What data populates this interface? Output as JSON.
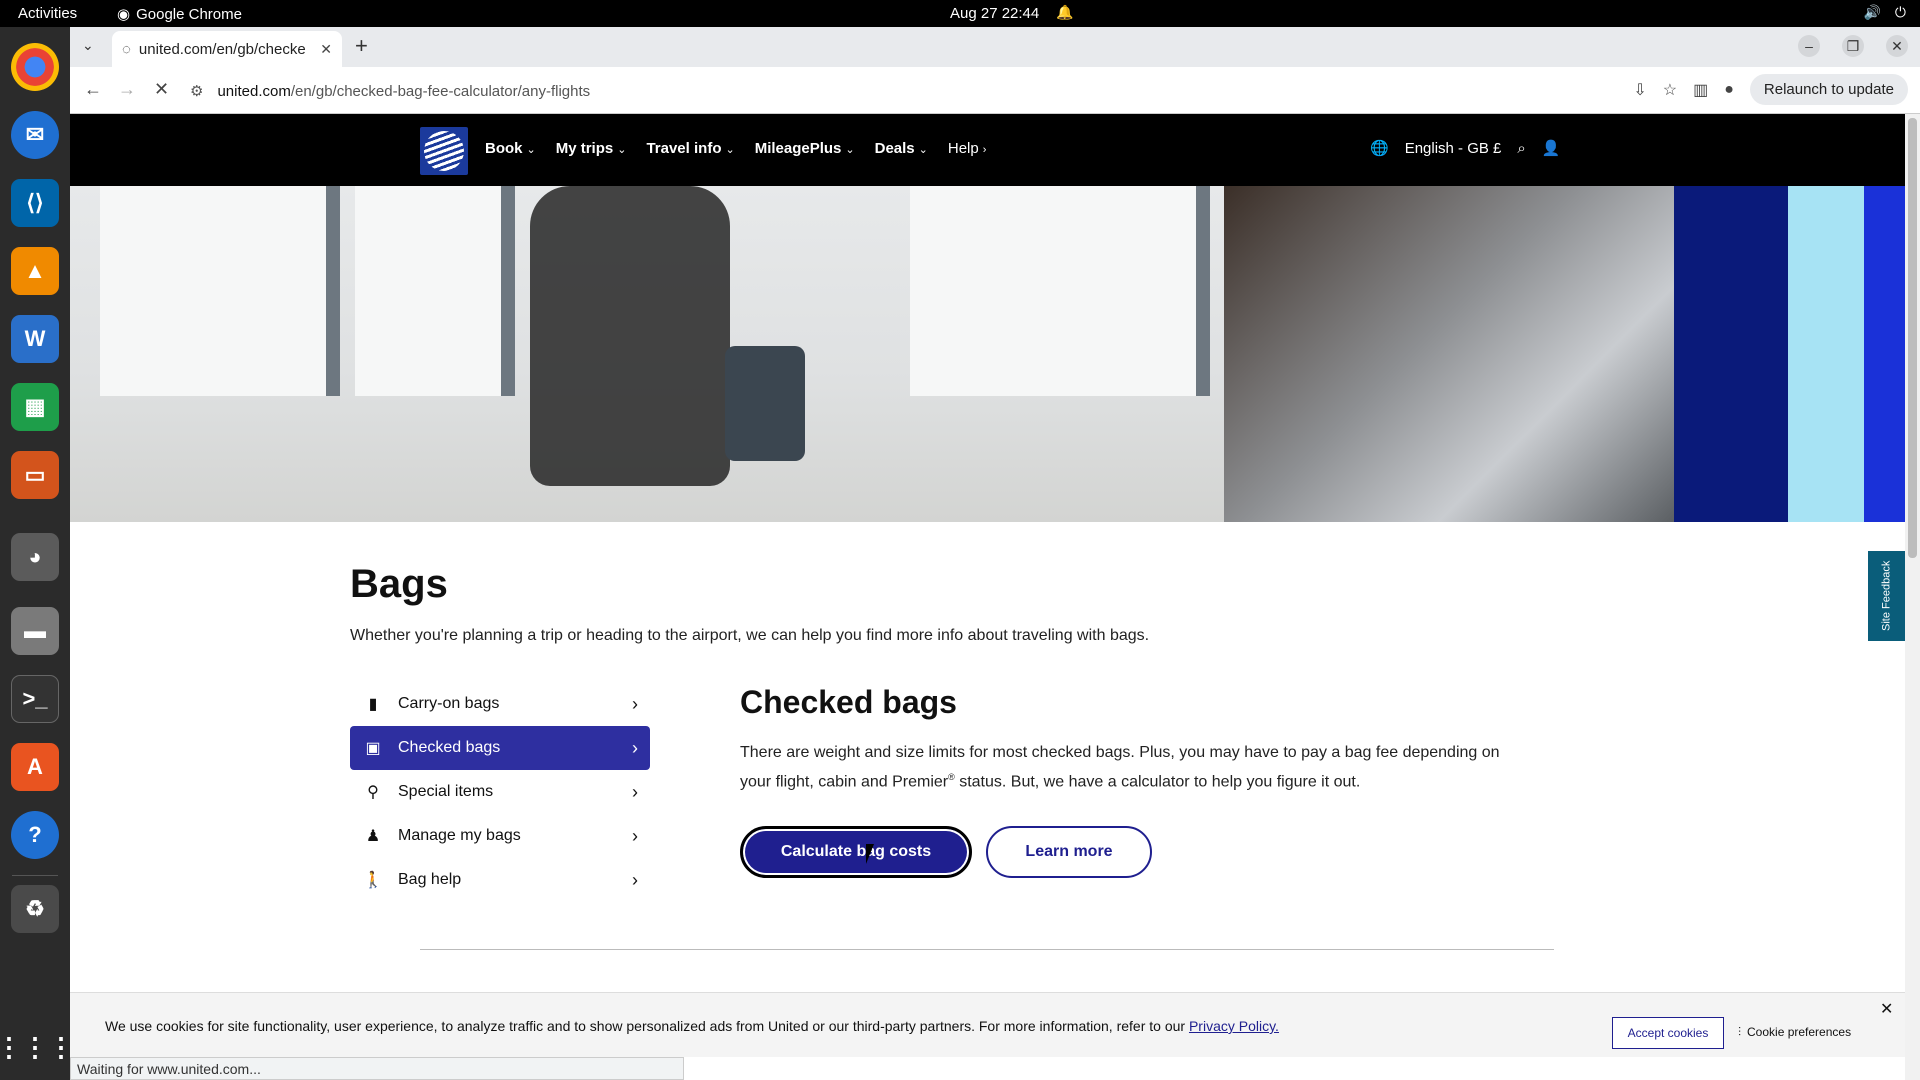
{
  "topbar": {
    "activities": "Activities",
    "app": "Google Chrome",
    "clock": "Aug 27  22:44"
  },
  "dock": {
    "apps": [
      "chrome-icon",
      "thunderbird-icon",
      "vscode-icon",
      "vlc-icon",
      "writer-icon",
      "calc-icon",
      "impress-icon",
      "gimp-icon",
      "files-icon",
      "terminal-icon",
      "appstore-icon",
      "help-icon",
      "trash-icon"
    ]
  },
  "browser": {
    "tab_title": "united.com/en/gb/checke",
    "url_host": "united.com",
    "url_path": "/en/gb/checked-bag-fee-calculator/any-flights",
    "relaunch": "Relaunch to update"
  },
  "nav": {
    "items": [
      "Book",
      "My trips",
      "Travel info",
      "MileagePlus",
      "Deals",
      "Help"
    ],
    "language": "English - GB £"
  },
  "bags": {
    "title": "Bags",
    "subtitle": "Whether you're planning a trip or heading to the airport, we can help you find more info about traveling with bags.",
    "side_items": [
      "Carry-on bags",
      "Checked bags",
      "Special items",
      "Manage my bags",
      "Bag help"
    ],
    "panel_title": "Checked bags",
    "panel_text_1": "There are weight and size limits for most checked bags. Plus, you may have to pay a bag fee depending on your flight, cabin and Premier",
    "panel_sup": "®",
    "panel_text_2": " status. But, we have a calculator to help you figure it out.",
    "primary_btn": "Calculate bag costs",
    "secondary_btn": "Learn more",
    "feedback": "Site Feedback"
  },
  "cookie": {
    "message": "We use cookies for site functionality, user experience, to analyze traffic and to show personalized ads from United or our third-party partners. For more information, refer to our ",
    "link": "Privacy Policy.",
    "accept": "Accept cookies",
    "prefs": "Cookie preferences"
  },
  "status": "Waiting for www.united.com...",
  "colors": {
    "united_blue": "#1f1f8f",
    "active_nav": "#2e2fa0"
  }
}
